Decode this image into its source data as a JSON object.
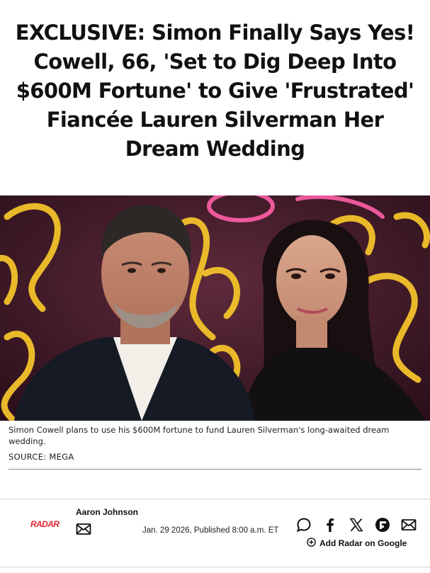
{
  "article": {
    "headline_lines": [
      "EXCLUSIVE: Simon Finally Says Yes!",
      "Cowell, 66, 'Set to Dig Deep Into",
      "$600M Fortune' to Give 'Frustrated'",
      "Fiancée Lauren Silverman Her",
      "Dream Wedding"
    ],
    "image": {
      "caption": "Simon Cowell plans to use his $600M fortune to fund Lauren Silverman's long-awaited dream wedding.",
      "source": "SOURCE: MEGA"
    }
  },
  "byline": {
    "brand_logo": "RADAR",
    "author": "Aaron Johnson",
    "author_email_icon": "mail-icon",
    "published": "Jan. 29 2026, Published 8:00 a.m. ET"
  },
  "share": {
    "icons": [
      "comment-icon",
      "facebook-icon",
      "x-icon",
      "flipboard-icon",
      "mail-icon"
    ],
    "add_google_label": "Add Radar on Google",
    "add_google_icon": "plus-circle-icon"
  },
  "colors": {
    "brand_red": "#e3262c",
    "text": "#111111"
  }
}
